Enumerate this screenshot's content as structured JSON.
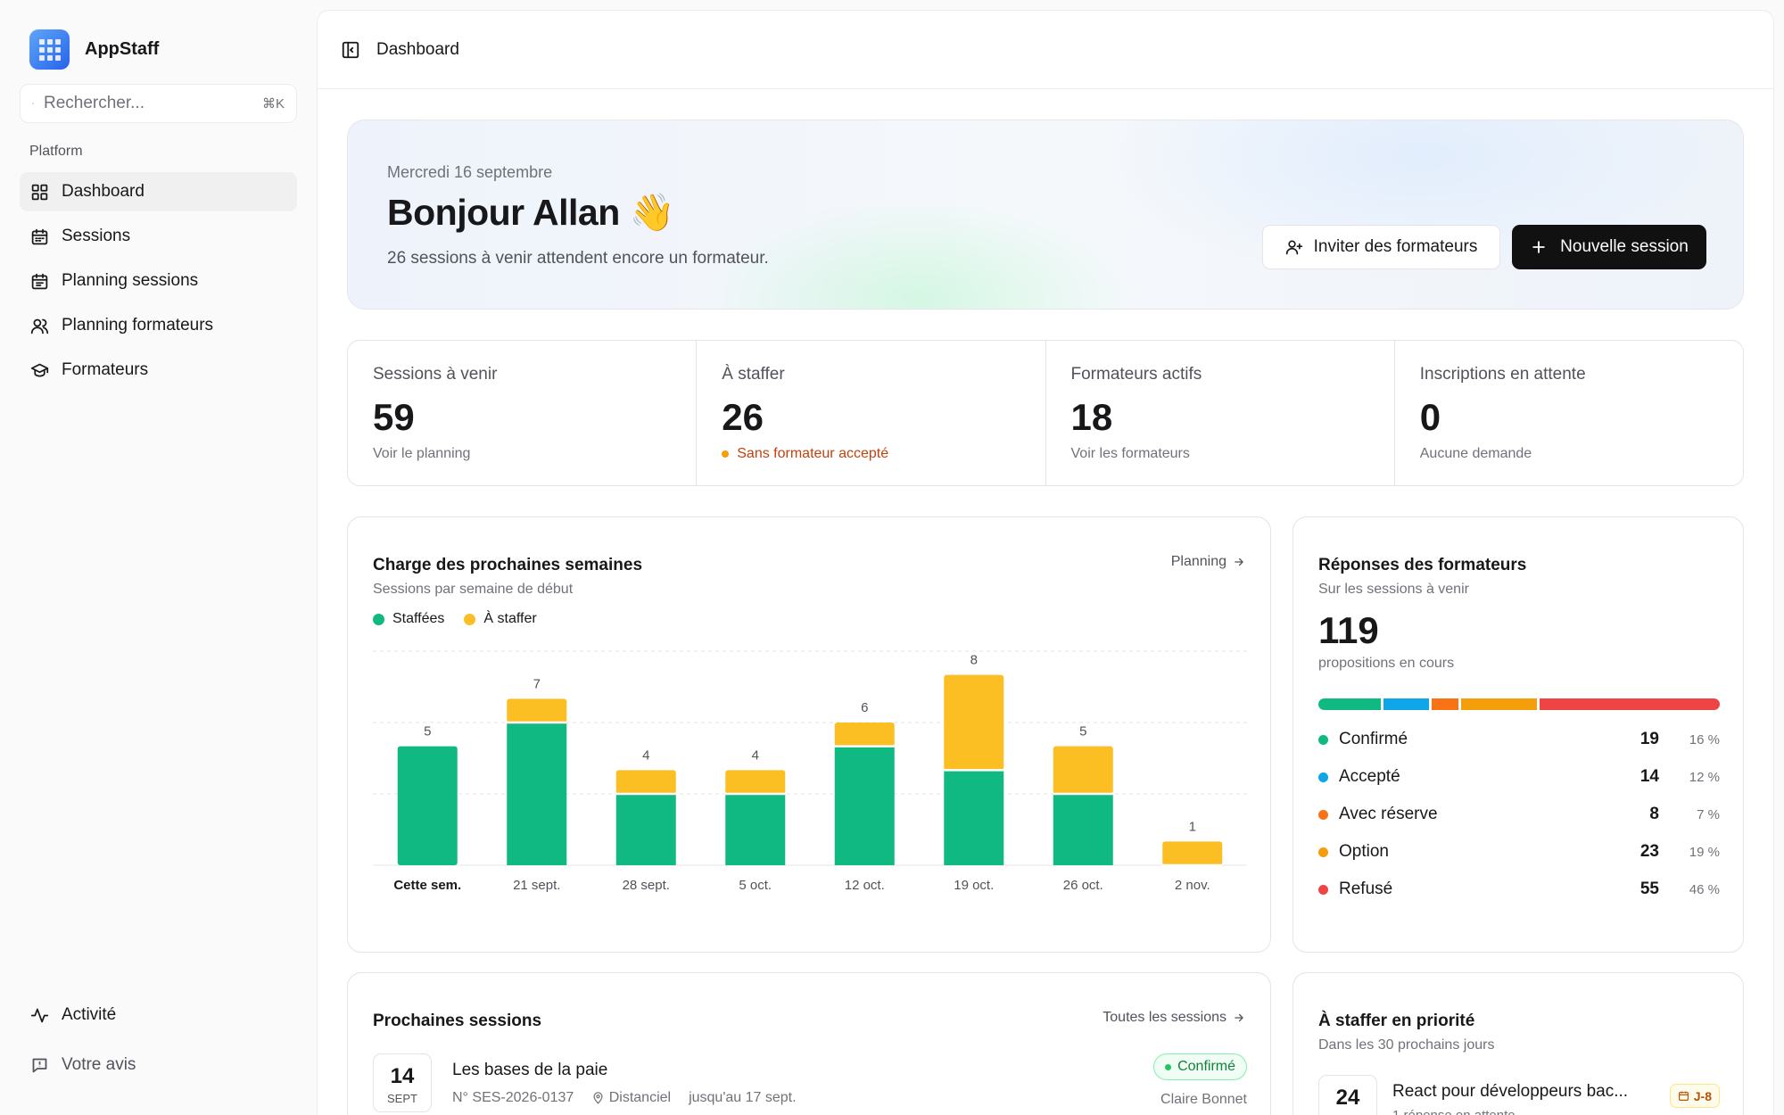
{
  "app": {
    "name": "AppStaff"
  },
  "search": {
    "placeholder": "Rechercher...",
    "shortcut": "⌘K"
  },
  "sidebar": {
    "section": "Platform",
    "items": [
      {
        "label": "Dashboard",
        "icon": "layout-grid-icon",
        "active": true
      },
      {
        "label": "Sessions",
        "icon": "calendar-icon"
      },
      {
        "label": "Planning sessions",
        "icon": "calendar-days-icon"
      },
      {
        "label": "Planning formateurs",
        "icon": "users-icon"
      },
      {
        "label": "Formateurs",
        "icon": "graduation-cap-icon"
      }
    ],
    "bottom": [
      {
        "label": "Activité",
        "icon": "activity-icon"
      },
      {
        "label": "Votre avis",
        "icon": "message-icon"
      }
    ]
  },
  "topbar": {
    "breadcrumb": "Dashboard"
  },
  "hero": {
    "date": "Mercredi 16 septembre",
    "greeting": "Bonjour Allan 👋",
    "subtitle": "26 sessions à venir attendent encore un formateur.",
    "invite_label": "Inviter des formateurs",
    "new_session_label": "Nouvelle session"
  },
  "stats": [
    {
      "label": "Sessions à venir",
      "value": "59",
      "foot": "Voir le planning"
    },
    {
      "label": "À staffer",
      "value": "26",
      "foot": "Sans formateur accepté",
      "warn": true
    },
    {
      "label": "Formateurs actifs",
      "value": "18",
      "foot": "Voir les formateurs"
    },
    {
      "label": "Inscriptions en attente",
      "value": "0",
      "foot": "Aucune demande"
    }
  ],
  "load_card": {
    "title": "Charge des prochaines semaines",
    "subtitle": "Sessions par semaine de début",
    "link": "Planning"
  },
  "chart_data": {
    "type": "bar",
    "stacked": true,
    "categories": [
      "Cette sem.",
      "21 sept.",
      "28 sept.",
      "5 oct.",
      "12 oct.",
      "19 oct.",
      "26 oct.",
      "2 nov."
    ],
    "series": [
      {
        "name": "Staffées",
        "color": "#10b981",
        "values": [
          5,
          6,
          3,
          3,
          5,
          4,
          3,
          0
        ]
      },
      {
        "name": "À staffer",
        "color": "#fbbf24",
        "values": [
          0,
          1,
          1,
          1,
          1,
          4,
          2,
          1
        ]
      }
    ],
    "totals": [
      5,
      7,
      4,
      4,
      6,
      8,
      5,
      1
    ],
    "ylim": [
      0,
      9
    ],
    "grid": true,
    "legend": "top-left"
  },
  "responses": {
    "title": "Réponses des formateurs",
    "subtitle": "Sur les sessions à venir",
    "total": "119",
    "total_label": "propositions en cours",
    "rows": [
      {
        "name": "Confirmé",
        "count": "19",
        "pct": "16 %",
        "color": "#10b981",
        "share": 19
      },
      {
        "name": "Accepté",
        "count": "14",
        "pct": "12 %",
        "color": "#0ea5e9",
        "share": 14
      },
      {
        "name": "Avec réserve",
        "count": "8",
        "pct": "7 %",
        "color": "#f97316",
        "share": 8
      },
      {
        "name": "Option",
        "count": "23",
        "pct": "19 %",
        "color": "#f59e0b",
        "share": 23
      },
      {
        "name": "Refusé",
        "count": "55",
        "pct": "46 %",
        "color": "#ef4444",
        "share": 55
      }
    ]
  },
  "next_sessions": {
    "title": "Prochaines sessions",
    "link": "Toutes les sessions",
    "items": [
      {
        "day": "14",
        "month": "SEPT",
        "name": "Les bases de la paie",
        "ref": "N° SES-2026-0137",
        "mode": "Distanciel",
        "until": "jusqu'au 17 sept.",
        "status": "Confirmé",
        "trainer": "Claire Bonnet"
      }
    ]
  },
  "priority": {
    "title": "À staffer en priorité",
    "subtitle": "Dans les 30 prochains jours",
    "items": [
      {
        "day": "24",
        "name": "React pour développeurs bac...",
        "sub": "1 réponse en attente",
        "badge": "J-8"
      }
    ]
  }
}
